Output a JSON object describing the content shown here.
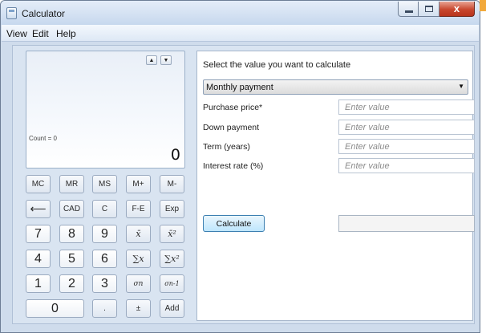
{
  "window": {
    "title": "Calculator"
  },
  "menu": [
    "View",
    "Edit",
    "Help"
  ],
  "display": {
    "count_label": "Count = 0",
    "value": "0"
  },
  "memory_keys": [
    "MC",
    "MR",
    "MS",
    "M+",
    "M-"
  ],
  "keypad": {
    "row1": [
      "⟵",
      "CAD",
      "C",
      "F-E",
      "Exp"
    ],
    "row2": [
      "7",
      "8",
      "9",
      "x̄",
      "x̄²"
    ],
    "row3": [
      "4",
      "5",
      "6",
      "∑x",
      "∑x²"
    ],
    "row4": [
      "1",
      "2",
      "3",
      "σn",
      "σn-1"
    ],
    "row5": [
      "0",
      ".",
      "±",
      "Add"
    ]
  },
  "worksheet": {
    "prompt": "Select the value you want to calculate",
    "dropdown_value": "Monthly payment",
    "fields": [
      {
        "label": "Purchase price*",
        "placeholder": "Enter value"
      },
      {
        "label": "Down payment",
        "placeholder": "Enter value"
      },
      {
        "label": "Term (years)",
        "placeholder": "Enter value"
      },
      {
        "label": "Interest rate (%)",
        "placeholder": "Enter value"
      }
    ],
    "calculate_label": "Calculate",
    "result_value": ""
  },
  "icons": {
    "app": "calculator-icon",
    "scroll_up": "triangle-up-icon",
    "scroll_down": "triangle-down-icon",
    "dropdown": "chevron-down-icon",
    "backspace": "left-arrow-icon"
  },
  "colors": {
    "accent": "#3c7fb1",
    "close_button": "#c8472e",
    "frame": "#cfdcec"
  }
}
